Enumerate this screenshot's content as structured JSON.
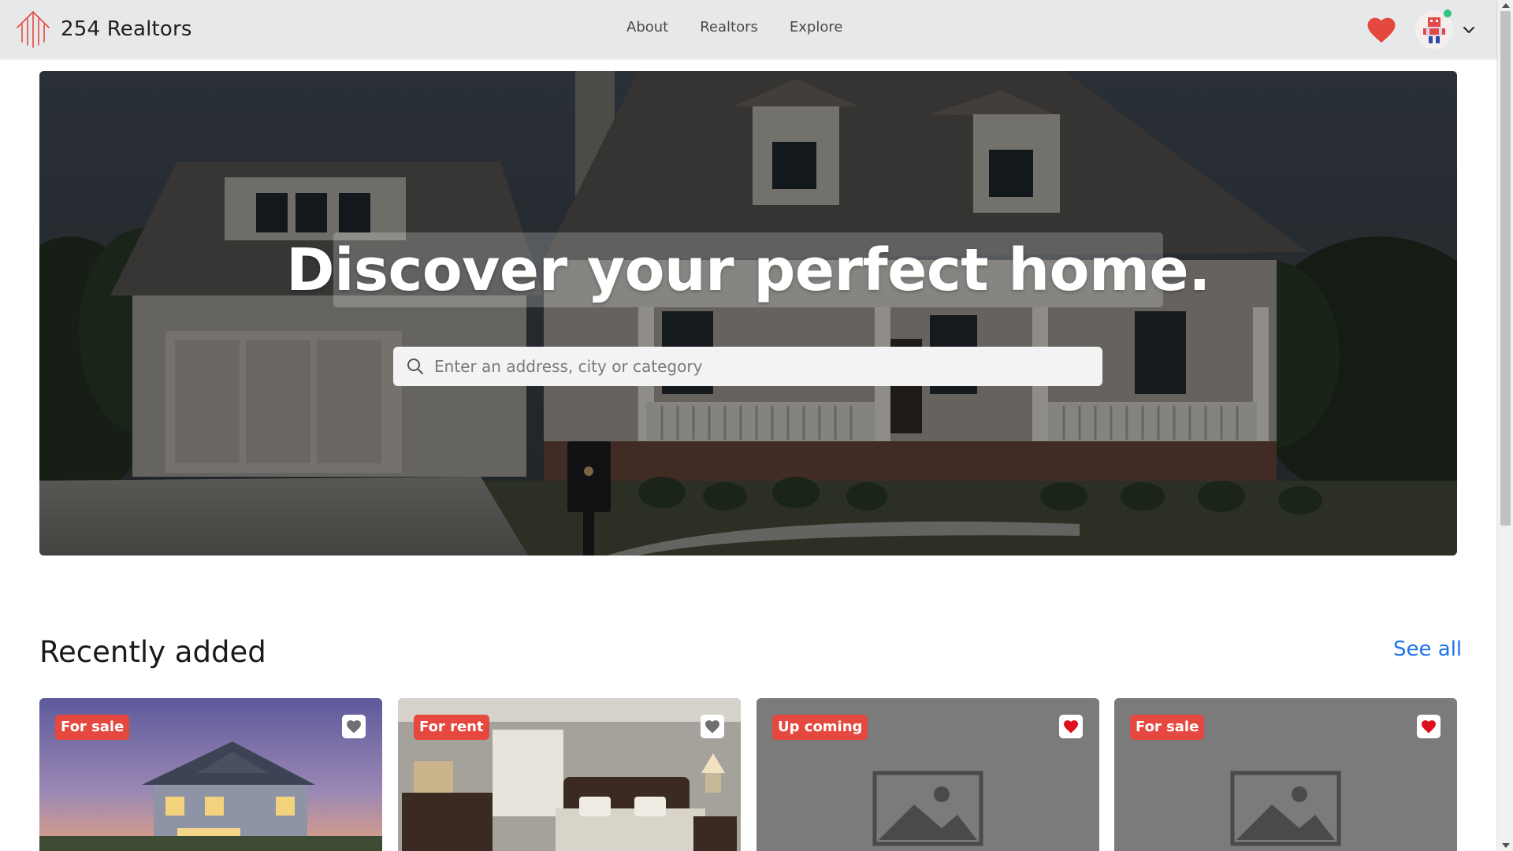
{
  "brand": {
    "name": "254 Realtors"
  },
  "nav": {
    "links": [
      "About",
      "Realtors",
      "Explore"
    ]
  },
  "colors": {
    "accent": "#e5483f",
    "link": "#1e73e8",
    "navbar_bg": "#e7e8ea",
    "online": "#31c27c"
  },
  "hero": {
    "title": "Discover your perfect home.",
    "search": {
      "placeholder": "Enter an address, city or category",
      "value": ""
    }
  },
  "recently_added": {
    "title": "Recently added",
    "see_all": "See all",
    "cards": [
      {
        "badge": "For sale",
        "favorited": false,
        "image": "house-exterior-photo"
      },
      {
        "badge": "For rent",
        "favorited": false,
        "image": "bedroom-photo"
      },
      {
        "badge": "Up coming",
        "favorited": true,
        "image": "image-placeholder-icon"
      },
      {
        "badge": "For sale",
        "favorited": true,
        "image": "image-placeholder-icon"
      }
    ]
  },
  "icons": {
    "logo": "building-lines-logo",
    "favorites": "heart-icon",
    "account_menu": "chevron-down-icon",
    "search": "search-icon"
  }
}
